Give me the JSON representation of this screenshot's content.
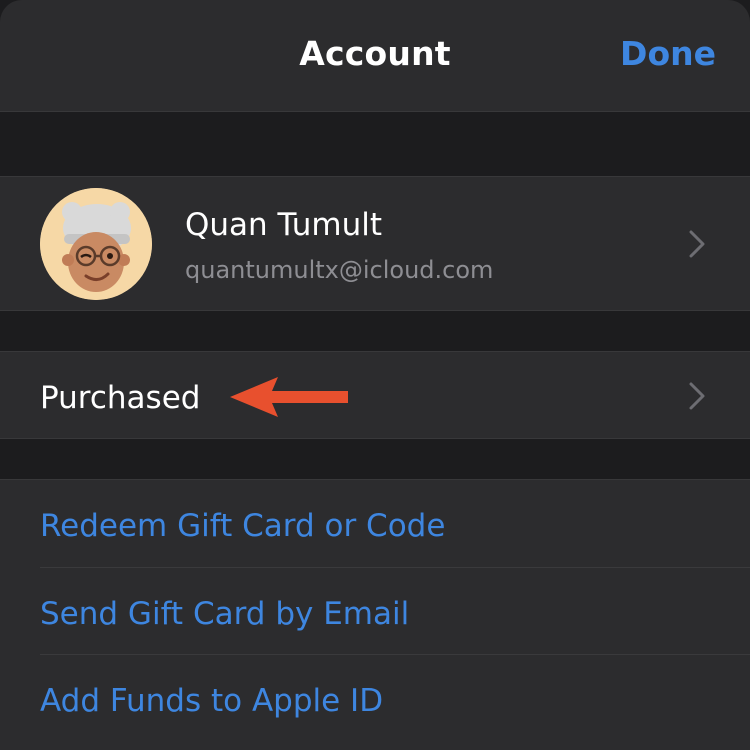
{
  "header": {
    "title": "Account",
    "done_label": "Done"
  },
  "profile": {
    "name": "Quan Tumult",
    "email": "quantumultx@icloud.com",
    "avatar_icon": "memoji-avatar-icon"
  },
  "purchased": {
    "label": "Purchased",
    "annotation_icon": "red-arrow-pointer-icon"
  },
  "links": [
    {
      "label": "Redeem Gift Card or Code"
    },
    {
      "label": "Send Gift Card by Email"
    },
    {
      "label": "Add Funds to Apple ID"
    }
  ],
  "colors": {
    "background": "#1c1c1e",
    "cell": "#2c2c2e",
    "accent": "#3e86e0",
    "annotation_arrow": "#e8502e"
  }
}
